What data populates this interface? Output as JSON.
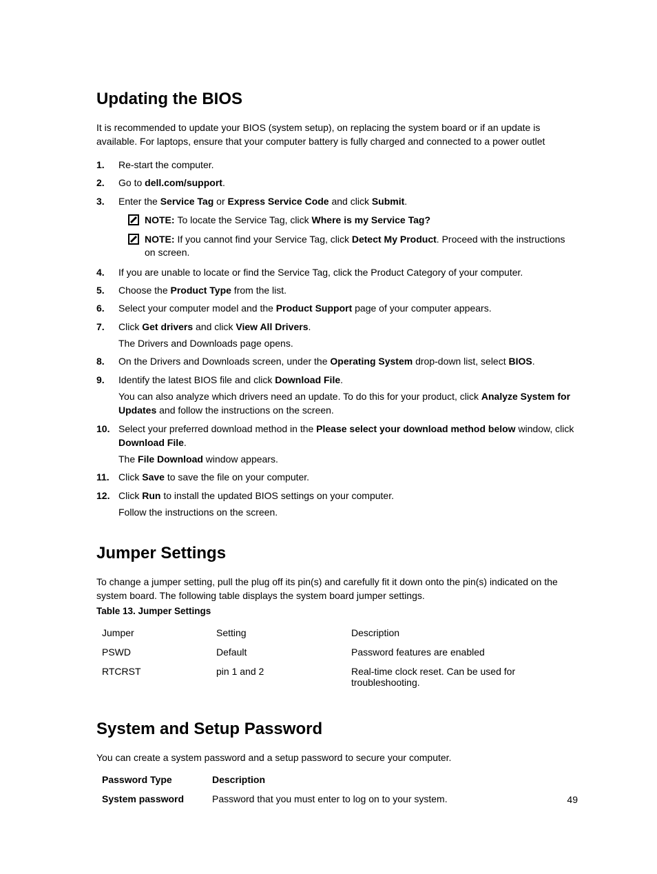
{
  "section1": {
    "heading": "Updating the BIOS",
    "intro": "It is recommended to update your BIOS (system setup), on replacing the system board or if an update is available. For laptops, ensure that your computer battery is fully charged and connected to a power outlet",
    "steps": {
      "s1": "Re-start the computer.",
      "s2_a": "Go to ",
      "s2_b": "dell.com/support",
      "s2_c": ".",
      "s3_a": "Enter the ",
      "s3_b": "Service Tag",
      "s3_c": " or ",
      "s3_d": "Express Service Code",
      "s3_e": " and click ",
      "s3_f": "Submit",
      "s3_g": ".",
      "note1_a": "NOTE: ",
      "note1_b": "To locate the Service Tag, click ",
      "note1_c": "Where is my Service Tag?",
      "note2_a": "NOTE: ",
      "note2_b": "If you cannot find your Service Tag, click ",
      "note2_c": "Detect My Product",
      "note2_d": ". Proceed with the instructions on screen.",
      "s4": "If you are unable to locate or find the Service Tag, click the Product Category of your computer.",
      "s5_a": "Choose the ",
      "s5_b": "Product Type",
      "s5_c": " from the list.",
      "s6_a": "Select your computer model and the ",
      "s6_b": "Product Support",
      "s6_c": " page of your computer appears.",
      "s7_a": "Click ",
      "s7_b": "Get drivers",
      "s7_c": " and click ",
      "s7_d": "View All Drivers",
      "s7_e": ".",
      "s7_f": "The Drivers and Downloads page opens.",
      "s8_a": "On the Drivers and Downloads screen, under the ",
      "s8_b": "Operating System",
      "s8_c": " drop-down list, select ",
      "s8_d": "BIOS",
      "s8_e": ".",
      "s9_a": "Identify the latest BIOS file and click ",
      "s9_b": "Download File",
      "s9_c": ".",
      "s9_d": "You can also analyze which drivers need an update. To do this for your product, click ",
      "s9_e": "Analyze System for Updates",
      "s9_f": " and follow the instructions on the screen.",
      "s10_a": "Select your preferred download method in the ",
      "s10_b": "Please select your download method below",
      "s10_c": " window, click ",
      "s10_d": "Download File",
      "s10_e": ".",
      "s10_f": "The ",
      "s10_g": "File Download",
      "s10_h": " window appears.",
      "s11_a": "Click ",
      "s11_b": "Save",
      "s11_c": " to save the file on your computer.",
      "s12_a": "Click ",
      "s12_b": "Run",
      "s12_c": " to install the updated BIOS settings on your computer.",
      "s12_d": "Follow the instructions on the screen."
    }
  },
  "section2": {
    "heading": "Jumper Settings",
    "intro": "To change a jumper setting, pull the plug off its pin(s) and carefully fit it down onto the pin(s) indicated on the system board. The following table displays the system board jumper settings.",
    "table_caption": "Table 13. Jumper Settings",
    "headers": {
      "c1": "Jumper",
      "c2": "Setting",
      "c3": "Description"
    },
    "rows": [
      {
        "c1": "PSWD",
        "c2": "Default",
        "c3": "Password features are enabled"
      },
      {
        "c1": "RTCRST",
        "c2": "pin 1 and 2",
        "c3": "Real-time clock reset. Can be used for troubleshooting."
      }
    ]
  },
  "section3": {
    "heading": "System and Setup Password",
    "intro": "You can create a system password and a setup password to secure your computer.",
    "def_headers": {
      "c1": "Password Type",
      "c2": "Description"
    },
    "rows": [
      {
        "c1": "System password",
        "c2": "Password that you must enter to log on to your system."
      }
    ]
  },
  "page_number": "49"
}
